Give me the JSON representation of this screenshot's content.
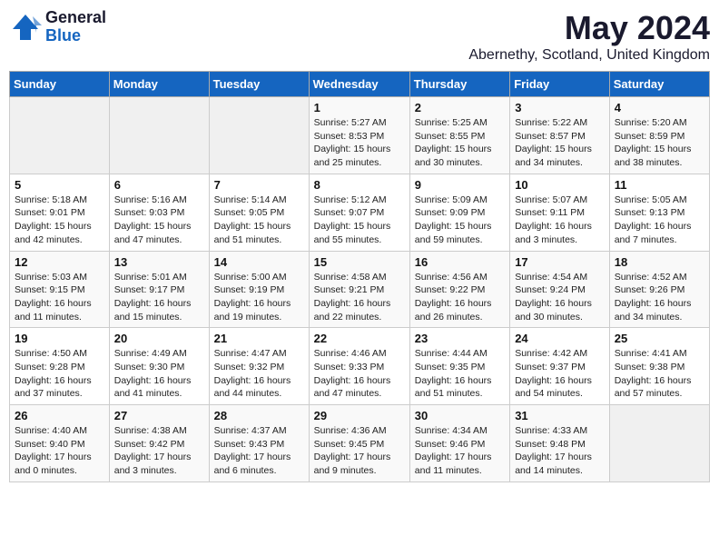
{
  "logo": {
    "general": "General",
    "blue": "Blue"
  },
  "title": "May 2024",
  "subtitle": "Abernethy, Scotland, United Kingdom",
  "days_of_week": [
    "Sunday",
    "Monday",
    "Tuesday",
    "Wednesday",
    "Thursday",
    "Friday",
    "Saturday"
  ],
  "weeks": [
    [
      {
        "day": "",
        "info": ""
      },
      {
        "day": "",
        "info": ""
      },
      {
        "day": "",
        "info": ""
      },
      {
        "day": "1",
        "info": "Sunrise: 5:27 AM\nSunset: 8:53 PM\nDaylight: 15 hours\nand 25 minutes."
      },
      {
        "day": "2",
        "info": "Sunrise: 5:25 AM\nSunset: 8:55 PM\nDaylight: 15 hours\nand 30 minutes."
      },
      {
        "day": "3",
        "info": "Sunrise: 5:22 AM\nSunset: 8:57 PM\nDaylight: 15 hours\nand 34 minutes."
      },
      {
        "day": "4",
        "info": "Sunrise: 5:20 AM\nSunset: 8:59 PM\nDaylight: 15 hours\nand 38 minutes."
      }
    ],
    [
      {
        "day": "5",
        "info": "Sunrise: 5:18 AM\nSunset: 9:01 PM\nDaylight: 15 hours\nand 42 minutes."
      },
      {
        "day": "6",
        "info": "Sunrise: 5:16 AM\nSunset: 9:03 PM\nDaylight: 15 hours\nand 47 minutes."
      },
      {
        "day": "7",
        "info": "Sunrise: 5:14 AM\nSunset: 9:05 PM\nDaylight: 15 hours\nand 51 minutes."
      },
      {
        "day": "8",
        "info": "Sunrise: 5:12 AM\nSunset: 9:07 PM\nDaylight: 15 hours\nand 55 minutes."
      },
      {
        "day": "9",
        "info": "Sunrise: 5:09 AM\nSunset: 9:09 PM\nDaylight: 15 hours\nand 59 minutes."
      },
      {
        "day": "10",
        "info": "Sunrise: 5:07 AM\nSunset: 9:11 PM\nDaylight: 16 hours\nand 3 minutes."
      },
      {
        "day": "11",
        "info": "Sunrise: 5:05 AM\nSunset: 9:13 PM\nDaylight: 16 hours\nand 7 minutes."
      }
    ],
    [
      {
        "day": "12",
        "info": "Sunrise: 5:03 AM\nSunset: 9:15 PM\nDaylight: 16 hours\nand 11 minutes."
      },
      {
        "day": "13",
        "info": "Sunrise: 5:01 AM\nSunset: 9:17 PM\nDaylight: 16 hours\nand 15 minutes."
      },
      {
        "day": "14",
        "info": "Sunrise: 5:00 AM\nSunset: 9:19 PM\nDaylight: 16 hours\nand 19 minutes."
      },
      {
        "day": "15",
        "info": "Sunrise: 4:58 AM\nSunset: 9:21 PM\nDaylight: 16 hours\nand 22 minutes."
      },
      {
        "day": "16",
        "info": "Sunrise: 4:56 AM\nSunset: 9:22 PM\nDaylight: 16 hours\nand 26 minutes."
      },
      {
        "day": "17",
        "info": "Sunrise: 4:54 AM\nSunset: 9:24 PM\nDaylight: 16 hours\nand 30 minutes."
      },
      {
        "day": "18",
        "info": "Sunrise: 4:52 AM\nSunset: 9:26 PM\nDaylight: 16 hours\nand 34 minutes."
      }
    ],
    [
      {
        "day": "19",
        "info": "Sunrise: 4:50 AM\nSunset: 9:28 PM\nDaylight: 16 hours\nand 37 minutes."
      },
      {
        "day": "20",
        "info": "Sunrise: 4:49 AM\nSunset: 9:30 PM\nDaylight: 16 hours\nand 41 minutes."
      },
      {
        "day": "21",
        "info": "Sunrise: 4:47 AM\nSunset: 9:32 PM\nDaylight: 16 hours\nand 44 minutes."
      },
      {
        "day": "22",
        "info": "Sunrise: 4:46 AM\nSunset: 9:33 PM\nDaylight: 16 hours\nand 47 minutes."
      },
      {
        "day": "23",
        "info": "Sunrise: 4:44 AM\nSunset: 9:35 PM\nDaylight: 16 hours\nand 51 minutes."
      },
      {
        "day": "24",
        "info": "Sunrise: 4:42 AM\nSunset: 9:37 PM\nDaylight: 16 hours\nand 54 minutes."
      },
      {
        "day": "25",
        "info": "Sunrise: 4:41 AM\nSunset: 9:38 PM\nDaylight: 16 hours\nand 57 minutes."
      }
    ],
    [
      {
        "day": "26",
        "info": "Sunrise: 4:40 AM\nSunset: 9:40 PM\nDaylight: 17 hours\nand 0 minutes."
      },
      {
        "day": "27",
        "info": "Sunrise: 4:38 AM\nSunset: 9:42 PM\nDaylight: 17 hours\nand 3 minutes."
      },
      {
        "day": "28",
        "info": "Sunrise: 4:37 AM\nSunset: 9:43 PM\nDaylight: 17 hours\nand 6 minutes."
      },
      {
        "day": "29",
        "info": "Sunrise: 4:36 AM\nSunset: 9:45 PM\nDaylight: 17 hours\nand 9 minutes."
      },
      {
        "day": "30",
        "info": "Sunrise: 4:34 AM\nSunset: 9:46 PM\nDaylight: 17 hours\nand 11 minutes."
      },
      {
        "day": "31",
        "info": "Sunrise: 4:33 AM\nSunset: 9:48 PM\nDaylight: 17 hours\nand 14 minutes."
      },
      {
        "day": "",
        "info": ""
      }
    ]
  ]
}
